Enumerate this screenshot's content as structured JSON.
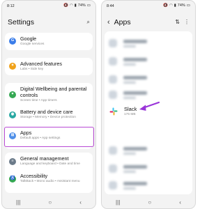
{
  "left": {
    "status": {
      "time": "8:12",
      "battery": "74%"
    },
    "title": "Settings",
    "items": [
      {
        "title": "Google",
        "subtitle": "Google services",
        "color": "#3b7de9",
        "glyph": "G"
      },
      {
        "title": "Advanced features",
        "subtitle": "Labs • Side key",
        "color": "#f0a21a",
        "glyph": "✦"
      },
      {
        "title": "Digital Wellbeing and parental controls",
        "subtitle": "Screen time • App timers",
        "color": "#35a853",
        "glyph": "♥"
      },
      {
        "title": "Battery and device care",
        "subtitle": "Storage • Memory • Device protection",
        "color": "#27a7a1",
        "glyph": "◉"
      },
      {
        "title": "Apps",
        "subtitle": "Default apps • App settings",
        "color": "#4f8fe8",
        "glyph": "⊞"
      },
      {
        "title": "General management",
        "subtitle": "Language and keyboard • Date and time",
        "color": "#6b7a89",
        "glyph": "≡"
      },
      {
        "title": "Accessibility",
        "subtitle": "TalkBack • Mono audio • Assistant menu",
        "color": "#35a853",
        "glyph": "♿"
      }
    ]
  },
  "right": {
    "status": {
      "time": "8:44",
      "battery": "74%"
    },
    "title": "Apps",
    "slack": {
      "name": "Slack",
      "size": "176 MB"
    },
    "colors": {
      "highlight": "#b84ad4",
      "arrow": "#9a35d9"
    }
  },
  "icons": {
    "search": "⌕",
    "back": "‹",
    "filter": "⇅",
    "more": "⋮",
    "nav_recent": "|||",
    "nav_home": "○",
    "nav_back": "‹"
  }
}
